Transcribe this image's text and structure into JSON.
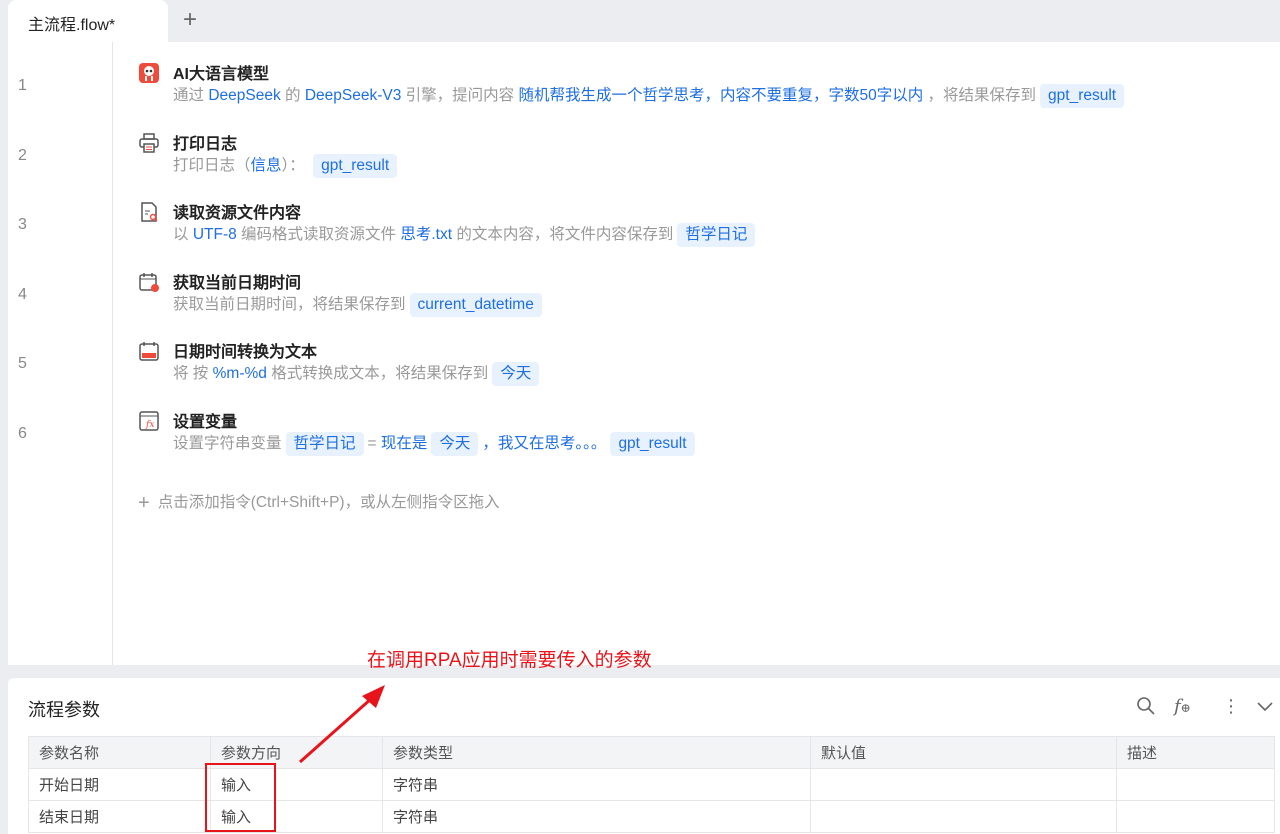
{
  "tabs": [
    {
      "label": "主流程.flow*"
    }
  ],
  "tab_add": "+",
  "steps": [
    {
      "line": "1",
      "icon": "ai-model-icon",
      "title": "AI大语言模型",
      "desc": [
        {
          "t": "通过 ",
          "k": "plain"
        },
        {
          "t": "DeepSeek",
          "k": "link"
        },
        {
          "t": " 的 ",
          "k": "plain"
        },
        {
          "t": "DeepSeek-V3",
          "k": "link"
        },
        {
          "t": " 引擎，提问内容 ",
          "k": "plain"
        },
        {
          "t": "随机帮我生成一个哲学思考，内容不要重复，字数50字以内",
          "k": "link"
        },
        {
          "t": " ，将结果保存到",
          "k": "plain"
        },
        {
          "t": "gpt_result",
          "k": "chip"
        }
      ]
    },
    {
      "line": "2",
      "icon": "printer-icon",
      "title": "打印日志",
      "desc": [
        {
          "t": "打印日志（",
          "k": "plain"
        },
        {
          "t": "信息",
          "k": "link"
        },
        {
          "t": "）： ",
          "k": "plain"
        },
        {
          "t": "gpt_result",
          "k": "chip"
        }
      ]
    },
    {
      "line": "3",
      "icon": "read-file-icon",
      "title": "读取资源文件内容",
      "desc": [
        {
          "t": "以 ",
          "k": "plain"
        },
        {
          "t": "UTF-8",
          "k": "link"
        },
        {
          "t": " 编码格式读取资源文件 ",
          "k": "plain"
        },
        {
          "t": "思考.txt",
          "k": "link"
        },
        {
          "t": " 的文本内容，将文件内容保存到",
          "k": "plain"
        },
        {
          "t": "哲学日记",
          "k": "chip"
        }
      ]
    },
    {
      "line": "4",
      "icon": "calendar-clock-icon",
      "title": "获取当前日期时间",
      "desc": [
        {
          "t": "获取当前日期时间，将结果保存到",
          "k": "plain"
        },
        {
          "t": "current_datetime",
          "k": "chip"
        }
      ]
    },
    {
      "line": "5",
      "icon": "calendar-text-icon",
      "title": "日期时间转换为文本",
      "desc": [
        {
          "t": "将 按 ",
          "k": "plain"
        },
        {
          "t": "%m-%d",
          "k": "link"
        },
        {
          "t": " 格式转换成文本，将结果保存到",
          "k": "plain"
        },
        {
          "t": "今天",
          "k": "chip"
        }
      ]
    },
    {
      "line": "6",
      "icon": "set-variable-icon",
      "title": "设置变量",
      "desc": [
        {
          "t": "设置字符串变量",
          "k": "plain"
        },
        {
          "t": "哲学日记",
          "k": "chip"
        },
        {
          "t": "= ",
          "k": "plain"
        },
        {
          "t": "现在是",
          "k": "link"
        },
        {
          "t": "今天",
          "k": "chip"
        },
        {
          "t": "，我又在思考。。。",
          "k": "link"
        },
        {
          "t": "gpt_result",
          "k": "chip"
        }
      ]
    }
  ],
  "add_command": {
    "icon": "+",
    "label": "点击添加指令(Ctrl+Shift+P)，或从左侧指令区拖入"
  },
  "annotation": "在调用RPA应用时需要传入的参数",
  "params": {
    "title": "流程参数",
    "columns": [
      "参数名称",
      "参数方向",
      "参数类型",
      "默认值",
      "描述"
    ],
    "rows": [
      [
        "开始日期",
        "输入",
        "字符串",
        "",
        ""
      ],
      [
        "结束日期",
        "输入",
        "字符串",
        "",
        ""
      ]
    ]
  },
  "colors": {
    "accent": "#1f6fe0",
    "chip_bg": "#e8f2fe",
    "annotation": "#e8141b"
  }
}
